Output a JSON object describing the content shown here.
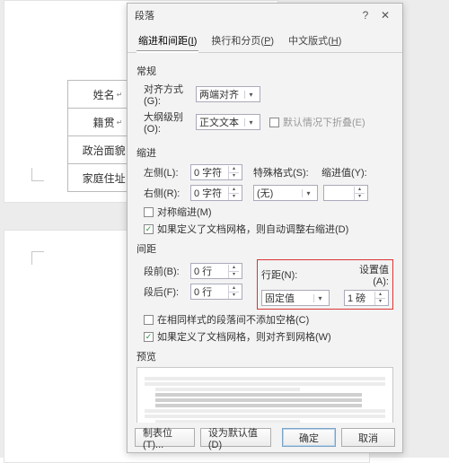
{
  "sidebar": {
    "cells": [
      "姓名",
      "籍贯",
      "政治面貌",
      "家庭住址"
    ]
  },
  "dialog": {
    "title": "段落",
    "tabs": {
      "t1": "缩进和间距",
      "t2": "换行和分页",
      "t3": "中文版式",
      "t1_u": "I",
      "t2_u": "P",
      "t3_u": "H"
    },
    "general": {
      "heading": "常规",
      "align_label": "对齐方式(G):",
      "align_value": "两端对齐",
      "outline_label": "大纲级别(O):",
      "outline_value": "正文文本",
      "collapse_label": "默认情况下折叠(E)"
    },
    "indent": {
      "heading": "缩进",
      "left_label": "左侧(L):",
      "left_value": "0 字符",
      "right_label": "右侧(R):",
      "right_value": "0 字符",
      "special_label": "特殊格式(S):",
      "special_value": "(无)",
      "by_label": "缩进值(Y):",
      "sym_label": "对称缩进(M)",
      "grid_label": "如果定义了文档网格，则自动调整右缩进(D)"
    },
    "spacing": {
      "heading": "间距",
      "before_label": "段前(B):",
      "before_value": "0 行",
      "after_label": "段后(F):",
      "after_value": "0 行",
      "line_label": "行距(N):",
      "line_value": "固定值",
      "at_label": "设置值(A):",
      "at_value": "1 磅",
      "nospace_label": "在相同样式的段落间不添加空格(C)",
      "grid_label": "如果定义了文档网格，则对齐到网格(W)"
    },
    "preview": {
      "heading": "预览"
    },
    "buttons": {
      "tabs": "制表位(T)...",
      "default": "设为默认值(D)",
      "ok": "确定",
      "cancel": "取消"
    }
  }
}
